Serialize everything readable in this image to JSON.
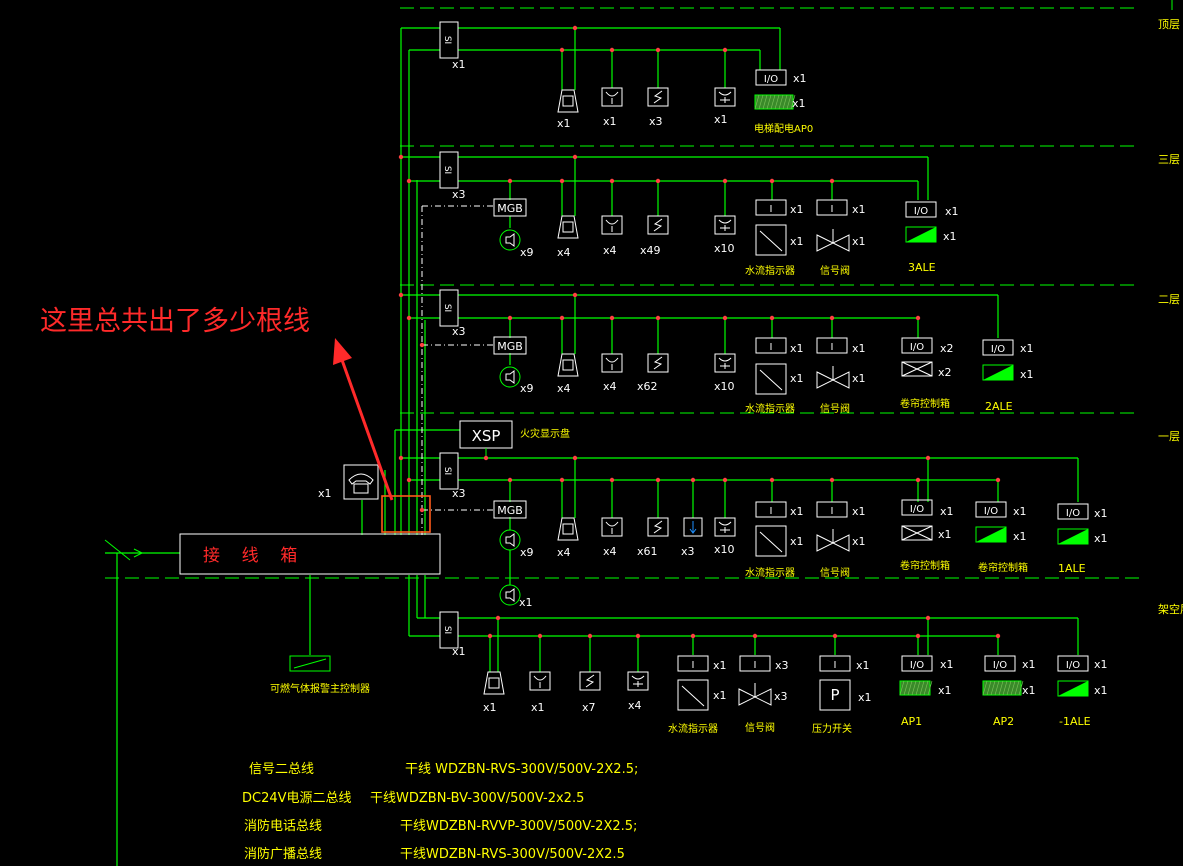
{
  "floors": {
    "top": "顶层",
    "f3": "三层",
    "f2": "二层",
    "f1": "一层",
    "basement": "架空层"
  },
  "question": "这里总共出了多少根线",
  "junction_box": "接    线    箱",
  "xsp": {
    "label": "XSP",
    "desc": "火灾显示盘"
  },
  "module_si": "SI",
  "mgb": "MGB",
  "io": "I/O",
  "i": "I",
  "p": "P",
  "counts": {
    "x1": "x1",
    "x2": "x2",
    "x3": "x3",
    "x4": "x4",
    "x7": "x7",
    "x9": "x9",
    "x10": "x10",
    "x49": "x49",
    "x62": "x62",
    "x61": "x61"
  },
  "labels": {
    "ap0": "电梯配电AP0",
    "ale3": "3ALE",
    "ale2": "2ALE",
    "ale1": "1ALE",
    "ale_b": "-1ALE",
    "ap1": "AP1",
    "ap2": "AP2",
    "water_flow": "水流指示器",
    "signal_valve": "信号阀",
    "shutter_box": "卷帘控制箱",
    "pressure_switch": "压力开关",
    "gas_controller": "可燃气体报警主控制器"
  },
  "legend": [
    {
      "name": "信号二总线",
      "spec": "干线 WDZBN-RVS-300V/500V-2X2.5;"
    },
    {
      "name": "DC24V电源二总线",
      "spec": "干线WDZBN-BV-300V/500V-2x2.5"
    },
    {
      "name": "消防电话总线",
      "spec": "干线WDZBN-RVVP-300V/500V-2X2.5;"
    },
    {
      "name": "消防广播总线",
      "spec": "干线WDZBN-RVS-300V/500V-2X2.5"
    }
  ],
  "colors": {
    "line": "#00ff00",
    "text": "#ffff00",
    "node": "#ff4040",
    "device": "#ffffff",
    "annotation": "#ff2a2a"
  }
}
